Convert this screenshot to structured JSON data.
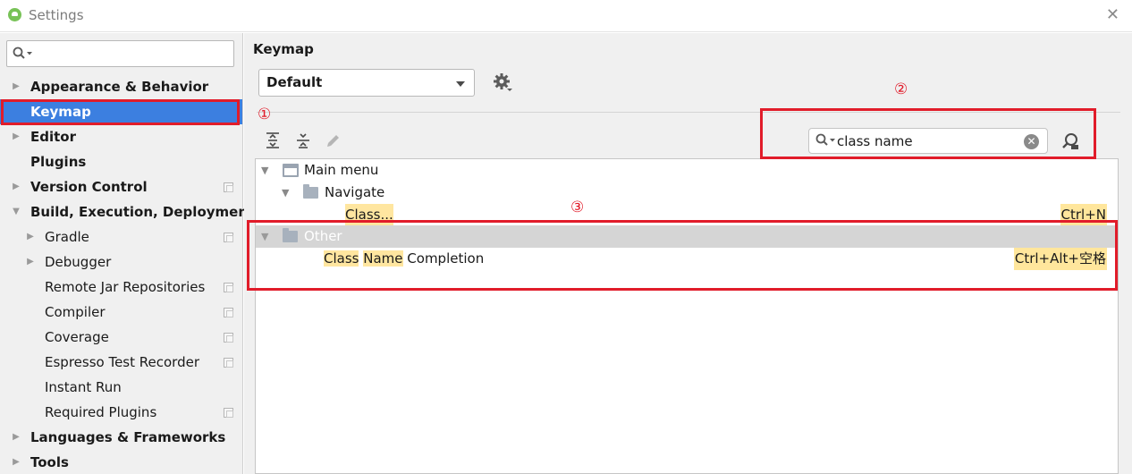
{
  "window": {
    "title": "Settings"
  },
  "sidebar": {
    "search_placeholder": "",
    "items": [
      {
        "label": "Appearance & Behavior"
      },
      {
        "label": "Keymap"
      },
      {
        "label": "Editor"
      },
      {
        "label": "Plugins"
      },
      {
        "label": "Version Control"
      },
      {
        "label": "Build, Execution, Deployment"
      },
      {
        "label": "Gradle"
      },
      {
        "label": "Debugger"
      },
      {
        "label": "Remote Jar Repositories"
      },
      {
        "label": "Compiler"
      },
      {
        "label": "Coverage"
      },
      {
        "label": "Espresso Test Recorder"
      },
      {
        "label": "Instant Run"
      },
      {
        "label": "Required Plugins"
      },
      {
        "label": "Languages & Frameworks"
      },
      {
        "label": "Tools"
      }
    ]
  },
  "main": {
    "title": "Keymap",
    "scheme": "Default",
    "search_value": "class name"
  },
  "tree": {
    "main_menu": "Main menu",
    "navigate": "Navigate",
    "class_action": "Class...",
    "class_shortcut": "Ctrl+N",
    "other": "Other",
    "completion_part1": "Class",
    "completion_part2": "Name",
    "completion_part3": "Completion",
    "completion_shortcut": "Ctrl+Alt+空格"
  },
  "annotations": {
    "one": "①",
    "two": "②",
    "three": "③"
  },
  "colors": {
    "selection": "#3c7fe0",
    "annotation_red": "#e11c2a",
    "highlight": "#ffe6a0"
  }
}
